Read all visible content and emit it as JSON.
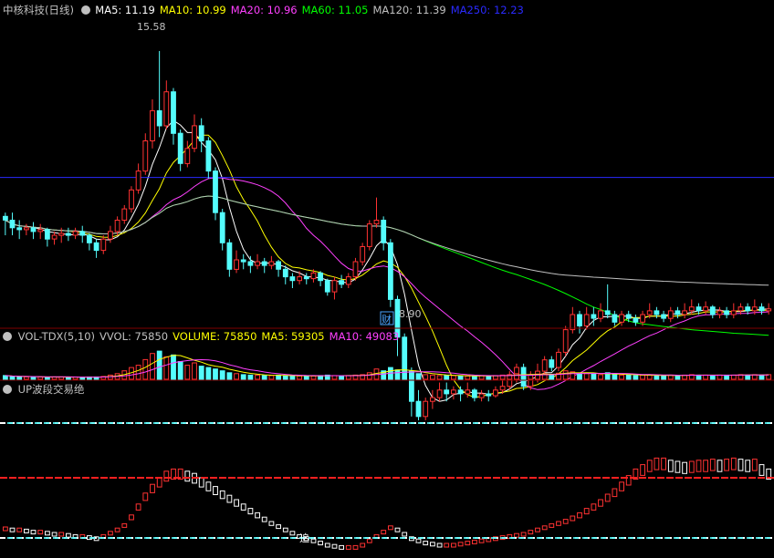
{
  "price_panel": {
    "title": "中核科技(日线)",
    "ma_labels": [
      {
        "text": "MA5: 11.19",
        "color": "#ffffff"
      },
      {
        "text": "MA10: 10.99",
        "color": "#ffff00"
      },
      {
        "text": "MA20: 10.96",
        "color": "#ff40ff"
      },
      {
        "text": "MA60: 11.05",
        "color": "#00ff00"
      },
      {
        "text": "MA120: 11.39",
        "color": "#c0c0c0"
      },
      {
        "text": "MA250: 12.23",
        "color": "#2a2aff"
      }
    ],
    "high_label": "15.58",
    "low_label": "8.90",
    "marker": "财"
  },
  "volume_panel": {
    "labels": [
      {
        "text": "VOL-TDX(5,10)",
        "color": "#c0c0c0"
      },
      {
        "text": "VVOL: 75850",
        "color": "#c0c0c0"
      },
      {
        "text": "VOLUME: 75850",
        "color": "#ffff00"
      },
      {
        "text": "MA5: 59305",
        "color": "#ffff00"
      },
      {
        "text": "MA10: 49083",
        "color": "#ff40ff"
      }
    ]
  },
  "indicator_panel": {
    "title": "UP波段交易绝",
    "marker": "追"
  },
  "colors": {
    "up": "#ff3232",
    "down": "#54fcfc",
    "background": "#000000",
    "divider": "#800000"
  },
  "chart_data": [
    {
      "type": "candlestick",
      "title": "中核科技(日线)",
      "ylim": [
        8.6,
        16.4
      ],
      "candles": [
        [
          11.2,
          11.1,
          11.3,
          10.7
        ],
        [
          11.1,
          10.9,
          11.3,
          10.7
        ],
        [
          10.9,
          10.85,
          11.1,
          10.6
        ],
        [
          10.85,
          10.9,
          11.0,
          10.7
        ],
        [
          10.9,
          10.8,
          11.05,
          10.6
        ],
        [
          10.8,
          10.85,
          11.0,
          10.6
        ],
        [
          10.85,
          10.6,
          10.9,
          10.4
        ],
        [
          10.6,
          10.7,
          10.8,
          10.45
        ],
        [
          10.7,
          10.75,
          10.9,
          10.5
        ],
        [
          10.75,
          10.7,
          10.9,
          10.55
        ],
        [
          10.7,
          10.8,
          10.9,
          10.6
        ],
        [
          10.8,
          10.7,
          10.95,
          10.5
        ],
        [
          10.7,
          10.5,
          10.75,
          10.3
        ],
        [
          10.5,
          10.3,
          10.6,
          10.1
        ],
        [
          10.3,
          10.6,
          10.7,
          10.2
        ],
        [
          10.6,
          10.8,
          10.95,
          10.5
        ],
        [
          10.8,
          11.1,
          11.2,
          10.7
        ],
        [
          11.1,
          11.4,
          11.5,
          11.0
        ],
        [
          11.4,
          11.9,
          12.0,
          11.3
        ],
        [
          11.9,
          12.4,
          12.6,
          11.8
        ],
        [
          12.4,
          13.2,
          13.4,
          12.3
        ],
        [
          13.2,
          14.0,
          14.3,
          13.0
        ],
        [
          14.0,
          13.6,
          15.58,
          13.3
        ],
        [
          13.6,
          14.5,
          14.8,
          13.5
        ],
        [
          14.5,
          13.4,
          14.6,
          13.1
        ],
        [
          13.4,
          12.6,
          13.5,
          12.4
        ],
        [
          12.6,
          13.0,
          13.2,
          12.5
        ],
        [
          13.0,
          13.6,
          13.9,
          12.9
        ],
        [
          13.6,
          13.2,
          13.8,
          12.9
        ],
        [
          13.2,
          12.4,
          13.3,
          12.2
        ],
        [
          12.4,
          11.3,
          12.5,
          11.1
        ],
        [
          11.3,
          10.5,
          11.4,
          10.3
        ],
        [
          10.5,
          9.8,
          10.6,
          9.6
        ],
        [
          9.8,
          10.05,
          10.3,
          9.7
        ],
        [
          10.05,
          10.0,
          10.2,
          9.8
        ],
        [
          10.0,
          9.9,
          10.15,
          9.7
        ],
        [
          9.9,
          10.0,
          10.2,
          9.8
        ],
        [
          10.0,
          9.9,
          10.1,
          9.7
        ],
        [
          9.9,
          10.0,
          10.15,
          9.8
        ],
        [
          10.0,
          9.8,
          10.05,
          9.6
        ],
        [
          9.8,
          9.6,
          9.9,
          9.4
        ],
        [
          9.6,
          9.5,
          9.7,
          9.3
        ],
        [
          9.5,
          9.6,
          9.75,
          9.4
        ],
        [
          9.6,
          9.55,
          9.7,
          9.4
        ],
        [
          9.55,
          9.7,
          9.8,
          9.45
        ],
        [
          9.7,
          9.5,
          9.75,
          9.35
        ],
        [
          9.5,
          9.2,
          9.55,
          9.1
        ],
        [
          9.2,
          9.5,
          9.6,
          9.0
        ],
        [
          9.5,
          9.4,
          9.65,
          9.3
        ],
        [
          9.4,
          9.6,
          9.7,
          9.3
        ],
        [
          9.6,
          10.0,
          10.1,
          9.5
        ],
        [
          10.0,
          10.4,
          10.5,
          9.9
        ],
        [
          10.4,
          11.0,
          11.1,
          10.3
        ],
        [
          11.0,
          11.1,
          11.7,
          10.9
        ],
        [
          11.1,
          10.5,
          11.2,
          10.3
        ],
        [
          10.5,
          9.0,
          10.6,
          8.8
        ],
        [
          9.0,
          8.0,
          9.1,
          7.5
        ],
        [
          8.0,
          7.1,
          8.1,
          6.9
        ],
        [
          7.1,
          6.3,
          7.2,
          5.9
        ],
        [
          6.3,
          5.9,
          6.6,
          5.8
        ],
        [
          5.9,
          6.3,
          6.4,
          5.8
        ],
        [
          6.3,
          6.4,
          6.6,
          6.1
        ],
        [
          6.4,
          6.6,
          6.8,
          6.3
        ],
        [
          6.6,
          6.5,
          6.8,
          6.3
        ],
        [
          6.5,
          6.6,
          6.7,
          6.35
        ],
        [
          6.6,
          6.5,
          6.7,
          6.3
        ],
        [
          6.5,
          6.6,
          6.8,
          6.4
        ],
        [
          6.6,
          6.4,
          6.65,
          6.3
        ],
        [
          6.4,
          6.5,
          6.6,
          6.3
        ],
        [
          6.5,
          6.45,
          6.6,
          6.3
        ],
        [
          6.45,
          6.6,
          6.7,
          6.4
        ],
        [
          6.6,
          6.7,
          6.9,
          6.5
        ],
        [
          6.7,
          6.9,
          7.1,
          6.6
        ],
        [
          6.9,
          7.2,
          7.3,
          6.8
        ],
        [
          7.2,
          6.7,
          7.3,
          6.6
        ],
        [
          6.7,
          6.9,
          7.1,
          6.6
        ],
        [
          6.9,
          7.1,
          7.3,
          6.8
        ],
        [
          7.1,
          7.4,
          7.5,
          7.0
        ],
        [
          7.4,
          7.2,
          7.5,
          7.1
        ],
        [
          7.2,
          7.6,
          7.7,
          7.1
        ],
        [
          7.6,
          8.2,
          8.3,
          7.5
        ],
        [
          8.2,
          8.6,
          8.8,
          8.1
        ],
        [
          8.6,
          8.3,
          8.7,
          8.1
        ],
        [
          8.3,
          8.6,
          8.8,
          8.2
        ],
        [
          8.6,
          8.5,
          8.8,
          8.3
        ],
        [
          8.5,
          8.7,
          8.9,
          8.4
        ],
        [
          8.7,
          8.6,
          9.4,
          8.5
        ],
        [
          8.6,
          8.4,
          8.7,
          8.3
        ],
        [
          8.4,
          8.6,
          8.7,
          8.3
        ],
        [
          8.6,
          8.5,
          8.7,
          8.4
        ],
        [
          8.5,
          8.4,
          8.6,
          8.3
        ],
        [
          8.4,
          8.6,
          8.7,
          8.3
        ],
        [
          8.6,
          8.7,
          8.9,
          8.5
        ],
        [
          8.7,
          8.6,
          8.8,
          8.5
        ],
        [
          8.6,
          8.5,
          8.7,
          8.4
        ],
        [
          8.5,
          8.7,
          8.8,
          8.4
        ],
        [
          8.7,
          8.6,
          8.8,
          8.5
        ],
        [
          8.6,
          8.7,
          8.9,
          8.5
        ],
        [
          8.7,
          8.8,
          9.0,
          8.6
        ],
        [
          8.8,
          8.7,
          8.9,
          8.6
        ],
        [
          8.7,
          8.8,
          8.95,
          8.6
        ],
        [
          8.8,
          8.6,
          8.85,
          8.5
        ],
        [
          8.6,
          8.7,
          8.8,
          8.5
        ],
        [
          8.7,
          8.6,
          8.8,
          8.5
        ],
        [
          8.6,
          8.7,
          8.9,
          8.5
        ],
        [
          8.7,
          8.8,
          8.9,
          8.6
        ],
        [
          8.8,
          8.7,
          8.9,
          8.6
        ],
        [
          8.7,
          8.8,
          9.0,
          8.6
        ],
        [
          8.8,
          8.7,
          8.9,
          8.6
        ],
        [
          8.7,
          8.75,
          8.9,
          8.6
        ]
      ],
      "annotations": [
        {
          "text": "15.58",
          "value": 15.58
        },
        {
          "text": "8.90",
          "value": 8.9
        }
      ]
    },
    {
      "type": "bar",
      "title": "VOL-TDX(5,10)",
      "volumes": [
        8,
        6,
        5,
        5,
        5,
        5,
        4,
        5,
        5,
        4,
        5,
        4,
        5,
        5,
        6,
        9,
        12,
        18,
        25,
        30,
        42,
        55,
        60,
        48,
        52,
        38,
        30,
        35,
        28,
        25,
        22,
        18,
        14,
        12,
        10,
        9,
        9,
        8,
        8,
        9,
        8,
        7,
        7,
        7,
        7,
        8,
        9,
        8,
        7,
        8,
        9,
        10,
        14,
        22,
        18,
        25,
        20,
        16,
        14,
        12,
        10,
        9,
        8,
        8,
        8,
        7,
        7,
        7,
        8,
        7,
        8,
        9,
        10,
        12,
        10,
        10,
        11,
        12,
        10,
        13,
        18,
        16,
        12,
        12,
        11,
        10,
        14,
        10,
        9,
        9,
        8,
        9,
        9,
        8,
        8,
        9,
        8,
        9,
        10,
        9,
        9,
        8,
        9,
        9,
        9,
        10,
        9,
        10,
        9,
        10
      ],
      "ylim": [
        0,
        70
      ]
    },
    {
      "type": "bar",
      "title": "UP波段交易绝",
      "values": [
        25,
        24,
        24,
        23,
        22,
        22,
        21,
        20,
        20,
        19,
        18,
        18,
        17,
        16,
        18,
        21,
        24,
        28,
        36,
        46,
        56,
        64,
        70,
        76,
        78,
        78,
        76,
        74,
        70,
        66,
        62,
        58,
        54,
        50,
        46,
        42,
        38,
        34,
        30,
        27,
        24,
        21,
        18,
        16,
        14,
        12,
        10,
        9,
        8,
        8,
        8,
        10,
        14,
        18,
        22,
        26,
        24,
        20,
        16,
        14,
        12,
        11,
        10,
        10,
        10,
        11,
        12,
        13,
        14,
        15,
        16,
        17,
        18,
        19,
        20,
        22,
        24,
        26,
        28,
        30,
        32,
        35,
        38,
        42,
        46,
        50,
        55,
        60,
        66,
        72,
        78,
        82,
        86,
        88,
        88,
        86,
        85,
        84,
        85,
        86,
        86,
        87,
        86,
        87,
        88,
        87,
        86,
        87,
        82,
        78
      ],
      "levels": [
        {
          "value": 15
        },
        {
          "value": 70
        },
        {
          "value": 120
        }
      ],
      "ylim": [
        0,
        140
      ]
    }
  ]
}
